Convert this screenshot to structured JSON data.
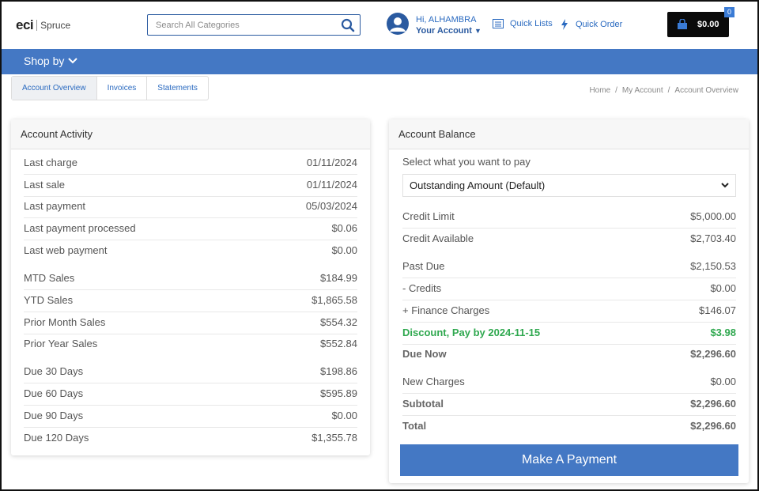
{
  "header": {
    "logo_eci": "eci",
    "logo_spruce": "Spruce",
    "search_placeholder": "Search All Categories",
    "greeting": "Hi, ALHAMBRA",
    "account_label": "Your Account",
    "quick_lists": "Quick Lists",
    "quick_order": "Quick Order",
    "cart_total": "$0.00",
    "cart_count": "0"
  },
  "nav": {
    "shop_by": "Shop by"
  },
  "tabs": [
    {
      "label": "Account Overview",
      "active": true
    },
    {
      "label": "Invoices",
      "active": false
    },
    {
      "label": "Statements",
      "active": false
    }
  ],
  "breadcrumb": [
    "Home",
    "My Account",
    "Account Overview"
  ],
  "activity": {
    "title": "Account Activity",
    "rows": [
      {
        "label": "Last charge",
        "value": "01/11/2024"
      },
      {
        "label": "Last sale",
        "value": "01/11/2024"
      },
      {
        "label": "Last payment",
        "value": "05/03/2024"
      },
      {
        "label": "Last payment processed",
        "value": "$0.06"
      },
      {
        "label": "Last web payment",
        "value": "$0.00"
      },
      {
        "label": "MTD Sales",
        "value": "$184.99"
      },
      {
        "label": "YTD Sales",
        "value": "$1,865.58"
      },
      {
        "label": "Prior Month Sales",
        "value": "$554.32"
      },
      {
        "label": "Prior Year Sales",
        "value": "$552.84"
      },
      {
        "label": "Due 30 Days",
        "value": "$198.86"
      },
      {
        "label": "Due 60 Days",
        "value": "$595.89"
      },
      {
        "label": "Due 90 Days",
        "value": "$0.00"
      },
      {
        "label": "Due 120 Days",
        "value": "$1,355.78"
      }
    ]
  },
  "balance": {
    "title": "Account Balance",
    "select_label": "Select what you want to pay",
    "select_value": "Outstanding Amount (Default)",
    "rows": [
      {
        "label": "Credit Limit",
        "value": "$5,000.00"
      },
      {
        "label": "Credit Available",
        "value": "$2,703.40"
      },
      {
        "label": "Past Due",
        "value": "$2,150.53"
      },
      {
        "label": "- Credits",
        "value": "$0.00"
      },
      {
        "label": "+ Finance Charges",
        "value": "$146.07"
      },
      {
        "label": "Discount, Pay by 2024-11-15",
        "value": "$3.98"
      },
      {
        "label": "Due Now",
        "value": "$2,296.60"
      },
      {
        "label": "New Charges",
        "value": "$0.00"
      },
      {
        "label": "Subtotal",
        "value": "$2,296.60"
      },
      {
        "label": "Total",
        "value": "$2,296.60"
      }
    ],
    "pay_button": "Make A Payment"
  },
  "colors": {
    "brand_blue": "#4478c4",
    "link_blue": "#2a6ac0",
    "discount_green": "#2fa84f"
  }
}
